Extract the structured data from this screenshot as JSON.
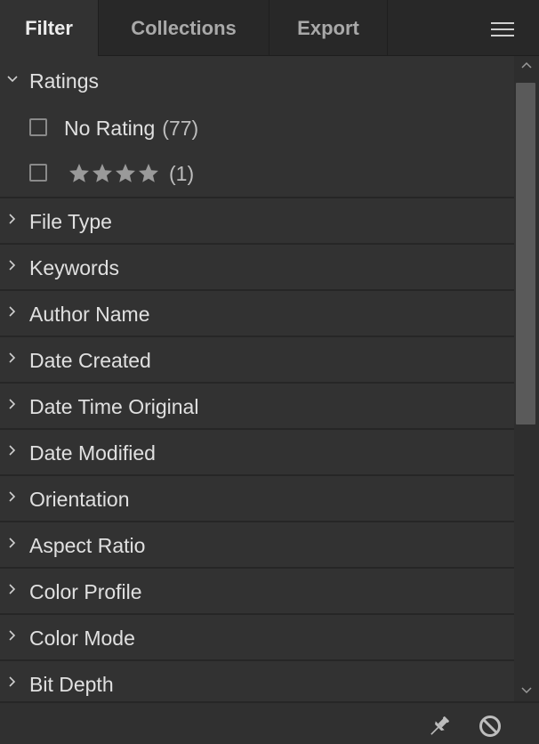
{
  "tabs": [
    {
      "label": "Filter",
      "active": true
    },
    {
      "label": "Collections",
      "active": false
    },
    {
      "label": "Export",
      "active": false
    }
  ],
  "menu_icon": "hamburger-menu-icon",
  "ratings": {
    "label": "Ratings",
    "expanded": true,
    "options": [
      {
        "label": "No Rating",
        "count": "(77)",
        "checked": false
      },
      {
        "label": "",
        "stars": 4,
        "count": "(1)",
        "checked": false
      }
    ]
  },
  "sections": [
    {
      "label": "File Type"
    },
    {
      "label": "Keywords"
    },
    {
      "label": "Author Name"
    },
    {
      "label": "Date Created"
    },
    {
      "label": "Date Time Original"
    },
    {
      "label": "Date Modified"
    },
    {
      "label": "Orientation"
    },
    {
      "label": "Aspect Ratio"
    },
    {
      "label": "Color Profile"
    },
    {
      "label": "Color Mode"
    },
    {
      "label": "Bit Depth"
    }
  ],
  "footer": {
    "pin_icon": "pin-icon",
    "clear_icon": "clear-filters-icon"
  },
  "colors": {
    "background": "#323232",
    "tabbar": "#282828",
    "text": "#e0e0e0",
    "star": "#9a9a9a"
  }
}
